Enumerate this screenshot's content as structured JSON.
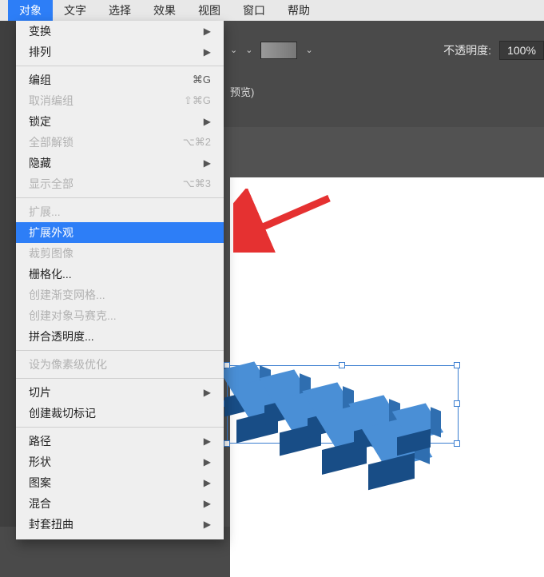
{
  "menubar": {
    "items": [
      "对象",
      "文字",
      "选择",
      "效果",
      "视图",
      "窗口",
      "帮助"
    ],
    "active_index": 0
  },
  "optionsbar": {
    "opacity_label": "不透明度:",
    "opacity_value": "100%"
  },
  "tabbar": {
    "label": "预览)"
  },
  "dropdown": {
    "groups": [
      [
        {
          "label": "变换",
          "submenu": true
        },
        {
          "label": "排列",
          "submenu": true
        }
      ],
      [
        {
          "label": "编组",
          "shortcut": "⌘G"
        },
        {
          "label": "取消编组",
          "shortcut": "⇧⌘G",
          "disabled": true
        },
        {
          "label": "锁定",
          "submenu": true
        },
        {
          "label": "全部解锁",
          "shortcut": "⌥⌘2",
          "disabled": true
        },
        {
          "label": "隐藏",
          "submenu": true
        },
        {
          "label": "显示全部",
          "shortcut": "⌥⌘3",
          "disabled": true
        }
      ],
      [
        {
          "label": "扩展...",
          "disabled": true
        },
        {
          "label": "扩展外观",
          "selected": true
        },
        {
          "label": "裁剪图像",
          "disabled": true
        },
        {
          "label": "栅格化..."
        },
        {
          "label": "创建渐变网格...",
          "disabled": true
        },
        {
          "label": "创建对象马赛克...",
          "disabled": true
        },
        {
          "label": "拼合透明度..."
        }
      ],
      [
        {
          "label": "设为像素级优化",
          "disabled": true
        }
      ],
      [
        {
          "label": "切片",
          "submenu": true
        },
        {
          "label": "创建裁切标记"
        }
      ],
      [
        {
          "label": "路径",
          "submenu": true
        },
        {
          "label": "形状",
          "submenu": true
        },
        {
          "label": "图案",
          "submenu": true
        },
        {
          "label": "混合",
          "submenu": true
        },
        {
          "label": "封套扭曲",
          "submenu": true
        }
      ]
    ]
  },
  "icons": {
    "chevron": "▶",
    "dropdown": "⌄"
  }
}
